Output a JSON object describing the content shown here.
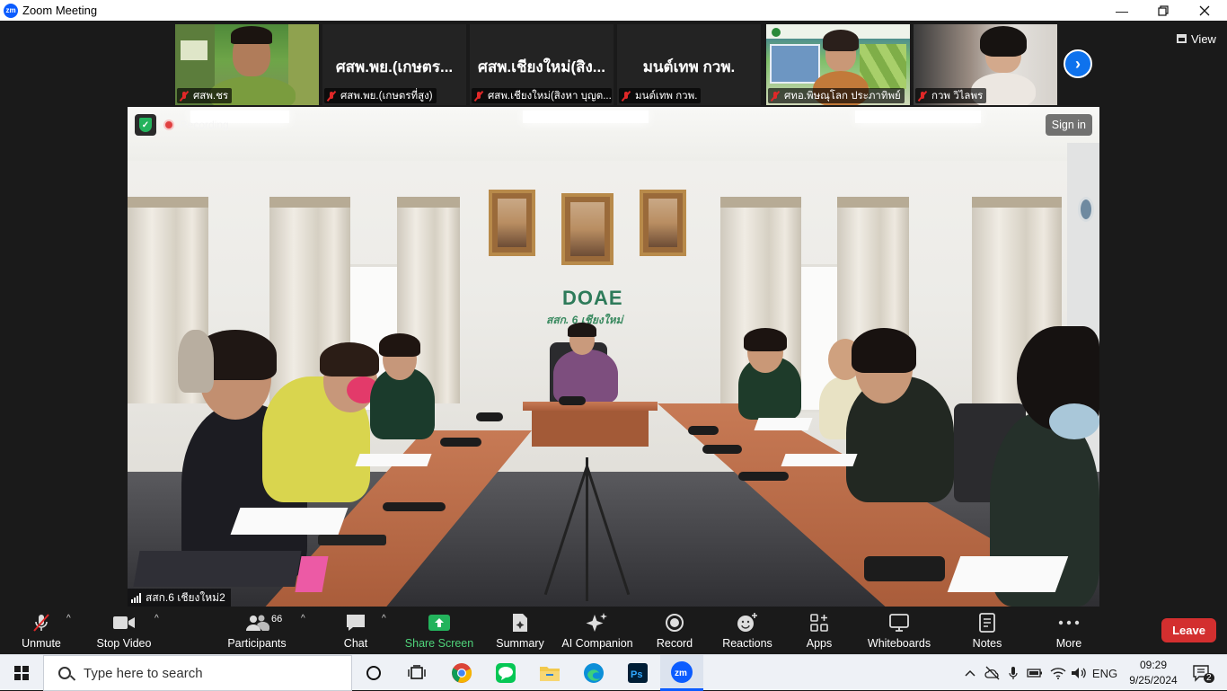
{
  "window": {
    "title": "Zoom Meeting",
    "controls": [
      "minimize",
      "restore",
      "close"
    ]
  },
  "gallery": {
    "view_label": "View",
    "tiles": [
      {
        "name": "ศสพ.ชร",
        "big_name": "",
        "video": true,
        "muted": true
      },
      {
        "name": "ศสพ.พย.(เกษตรที่สูง)",
        "big_name": "ศสพ.พย.(เกษตร...",
        "video": false,
        "muted": true
      },
      {
        "name": "ศสพ.เชียงใหม่(สิงหา บุญต...",
        "big_name": "ศสพ.เชียงใหม่(สิง...",
        "video": false,
        "muted": true
      },
      {
        "name": "มนต์เทพ กวพ.",
        "big_name": "มนต์เทพ กวพ.",
        "video": false,
        "muted": true
      },
      {
        "name": "ศทอ.พิษณุโลก ประภาทิพย์",
        "big_name": "",
        "video": true,
        "muted": true
      },
      {
        "name": "กวพ วิไลพร",
        "big_name": "",
        "video": true,
        "muted": true
      }
    ]
  },
  "main_video": {
    "recording_label": "Recording",
    "sign_in_label": "Sign in",
    "speaker_name": "สสก.6 เชียงใหม่2",
    "banner_text": "DOAE",
    "banner_subtext": "สสก. 6 เชียงใหม่"
  },
  "toolbar": {
    "unmute": "Unmute",
    "stop_video": "Stop Video",
    "participants": "Participants",
    "participants_count": "66",
    "chat": "Chat",
    "share_screen": "Share Screen",
    "summary": "Summary",
    "ai_companion": "AI Companion",
    "record": "Record",
    "reactions": "Reactions",
    "apps": "Apps",
    "whiteboards": "Whiteboards",
    "notes": "Notes",
    "more": "More",
    "leave": "Leave"
  },
  "taskbar": {
    "search_placeholder": "Type here to search",
    "language": "ENG",
    "time": "09:29",
    "date": "9/25/2024",
    "notification_count": "2"
  },
  "colors": {
    "zoom_blue": "#0b5cff",
    "leave_red": "#d32f2f",
    "share_green": "#23b35c",
    "meeting_bg": "#1a1a1a"
  }
}
